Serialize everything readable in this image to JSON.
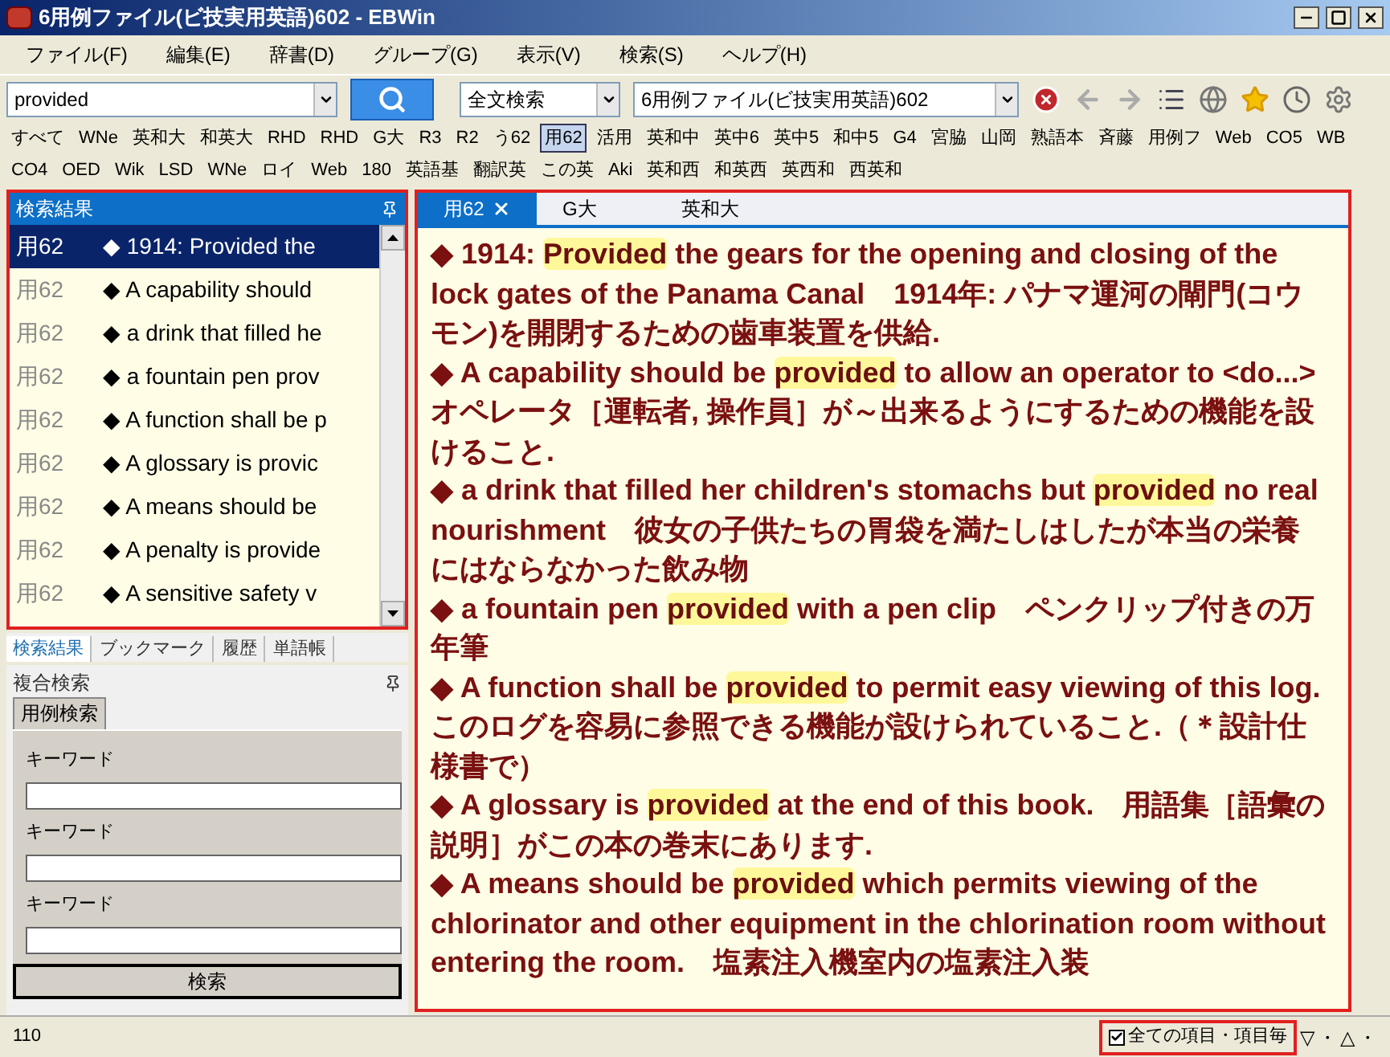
{
  "window": {
    "title": "6用例ファイル(ビ技実用英語)602 - EBWin"
  },
  "menu": [
    "ファイル(F)",
    "編集(E)",
    "辞書(D)",
    "グループ(G)",
    "表示(V)",
    "検索(S)",
    "ヘルプ(H)"
  ],
  "toolbar": {
    "query": "provided",
    "mode": "全文検索",
    "dictionary": "6用例ファイル(ビ技実用英語)602"
  },
  "dictionaries": [
    [
      {
        "label": "すべて",
        "selected": false
      },
      {
        "label": "WNe",
        "selected": false
      },
      {
        "label": "英和大",
        "selected": false
      },
      {
        "label": "和英大",
        "selected": false
      },
      {
        "label": "RHD",
        "selected": false
      },
      {
        "label": "RHD",
        "selected": false
      },
      {
        "label": "G大",
        "selected": false
      },
      {
        "label": "R3",
        "selected": false
      },
      {
        "label": "R2",
        "selected": false
      },
      {
        "label": "う62",
        "selected": false
      },
      {
        "label": "用62",
        "selected": true
      },
      {
        "label": "活用",
        "selected": false
      },
      {
        "label": "英和中",
        "selected": false
      },
      {
        "label": "英中6",
        "selected": false
      },
      {
        "label": "英中5",
        "selected": false
      },
      {
        "label": "和中5",
        "selected": false
      },
      {
        "label": "G4",
        "selected": false
      },
      {
        "label": "宮脇",
        "selected": false
      },
      {
        "label": "山岡",
        "selected": false
      },
      {
        "label": "熟語本",
        "selected": false
      },
      {
        "label": "斉藤",
        "selected": false
      },
      {
        "label": "用例フ",
        "selected": false
      },
      {
        "label": "Web",
        "selected": false
      },
      {
        "label": "CO5",
        "selected": false
      },
      {
        "label": "WB",
        "selected": false
      }
    ],
    [
      {
        "label": "CO4",
        "selected": false
      },
      {
        "label": "OED",
        "selected": false
      },
      {
        "label": "Wik",
        "selected": false
      },
      {
        "label": "LSD",
        "selected": false
      },
      {
        "label": "WNe",
        "selected": false
      },
      {
        "label": "ロイ",
        "selected": false
      },
      {
        "label": "Web",
        "selected": false
      },
      {
        "label": "180",
        "selected": false
      },
      {
        "label": "英語基",
        "selected": false
      },
      {
        "label": "翻訳英",
        "selected": false
      },
      {
        "label": "この英",
        "selected": false
      },
      {
        "label": "Aki",
        "selected": false
      },
      {
        "label": "英和西",
        "selected": false
      },
      {
        "label": "和英西",
        "selected": false
      },
      {
        "label": "英西和",
        "selected": false
      },
      {
        "label": "西英和",
        "selected": false
      }
    ]
  ],
  "results": {
    "title": "検索結果",
    "items": [
      {
        "dict": "用62",
        "text": "◆ 1914: Provided the",
        "selected": true
      },
      {
        "dict": "用62",
        "text": "◆ A capability should",
        "selected": false
      },
      {
        "dict": "用62",
        "text": "◆ a drink that filled he",
        "selected": false
      },
      {
        "dict": "用62",
        "text": "◆ a fountain pen prov",
        "selected": false
      },
      {
        "dict": "用62",
        "text": "◆ A function shall be p",
        "selected": false
      },
      {
        "dict": "用62",
        "text": "◆ A glossary is provic",
        "selected": false
      },
      {
        "dict": "用62",
        "text": "◆ A means should be",
        "selected": false
      },
      {
        "dict": "用62",
        "text": "◆ A penalty is provide",
        "selected": false
      },
      {
        "dict": "用62",
        "text": "◆ A sensitive safety v",
        "selected": false
      }
    ]
  },
  "left_tabs": [
    {
      "label": "検索結果",
      "selected": true
    },
    {
      "label": "ブックマーク",
      "selected": false
    },
    {
      "label": "履歴",
      "selected": false
    },
    {
      "label": "単語帳",
      "selected": false
    }
  ],
  "compound_search": {
    "title": "複合検索",
    "tab": "用例検索",
    "fields": [
      {
        "label": "キーワード"
      },
      {
        "label": "キーワード"
      },
      {
        "label": "キーワード"
      }
    ],
    "button": "検索"
  },
  "content_tabs": [
    {
      "label": "用62",
      "selected": true
    },
    {
      "label": "G大",
      "selected": false
    },
    {
      "label": "英和大",
      "selected": false
    }
  ],
  "entries": [
    {
      "before": "◆ 1914: ",
      "keyword": "Provided",
      "after": " the gears for the opening and closing of the lock gates of the Panama Canal　1914年: パナマ運河の閘門(コウモン)を開閉するための歯車装置を供給."
    },
    {
      "before": "◆ A capability should be ",
      "keyword": "provided",
      "after": " to allow an operator to <do...>　オペレータ［運転者, 操作員］が～出来るようにするための機能を設けること."
    },
    {
      "before": "◆ a drink that filled her children's stomachs but ",
      "keyword": "provided",
      "after": " no real nourishment　彼女の子供たちの胃袋を満たしはしたが本当の栄養にはならなかった飲み物"
    },
    {
      "before": "◆ a fountain pen ",
      "keyword": "provided",
      "after": " with a pen clip　ペンクリップ付きの万年筆"
    },
    {
      "before": "◆ A function shall be ",
      "keyword": "provided",
      "after": " to permit easy viewing of this log.　このログを容易に参照できる機能が設けられていること.（＊設計仕様書で）"
    },
    {
      "before": "◆ A glossary is ",
      "keyword": "provided",
      "after": " at the end of this book.　用語集［語彙の説明］がこの本の巻末にあります."
    },
    {
      "before": "◆ A means should be ",
      "keyword": "provided",
      "after": " which permits viewing of the chlorinator and other equipment in the chlorination room without entering the room.　塩素注入機室内の塩素注入装"
    }
  ],
  "status_bar": {
    "count": "110",
    "option": {
      "label": "全ての項目・項目毎",
      "checked": true
    },
    "marks": [
      "▽",
      "・",
      "△",
      "・"
    ]
  }
}
